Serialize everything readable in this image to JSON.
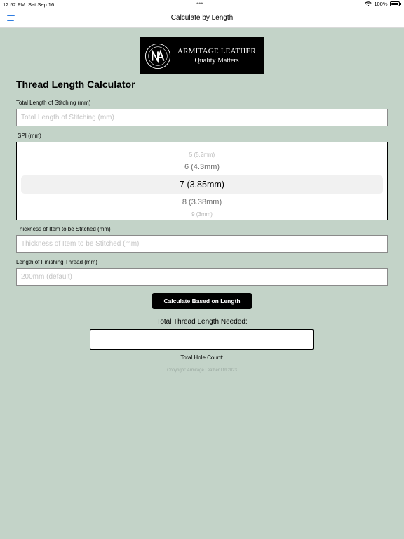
{
  "status": {
    "time": "12:52 PM",
    "date": "Sat Sep 16",
    "dots": "•••",
    "battery": "100%"
  },
  "nav": {
    "title": "Calculate by Length"
  },
  "logo": {
    "line1": "ARMITAGE LEATHER",
    "line2": "Quality Matters"
  },
  "page": {
    "heading": "Thread Length Calculator"
  },
  "form": {
    "stitching_label": "Total Length of Stitching (mm)",
    "stitching_placeholder": "Total Length of Stitching (mm)",
    "spi_label": "SPI (mm)",
    "spi_options": [
      "5 (5.2mm)",
      "6 (4.3mm)",
      "7 (3.85mm)",
      "8 (3.38mm)",
      "9 (3mm)"
    ],
    "thickness_label": "Thickness of Item to be Stitched (mm)",
    "thickness_placeholder": "Thickness of Item to be Stitched (mm)",
    "finishing_label": "Length of Finishing Thread (mm)",
    "finishing_placeholder": "200mm (default)",
    "button_label": "Calculate Based on Length"
  },
  "result": {
    "total_label": "Total Thread Length Needed:",
    "total_value": "",
    "hole_count_label": "Total Hole Count:"
  },
  "footer": {
    "copyright": "Copyright: Armitage Leather Ltd 2023"
  }
}
